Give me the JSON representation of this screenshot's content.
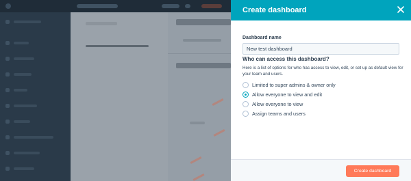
{
  "drawer": {
    "title": "Create dashboard",
    "close_icon": "close-icon",
    "name_label": "Dashboard name",
    "name_value": "New test dashboard",
    "access_heading": "Who can access this dashboard?",
    "access_description": "Here is a list of options for who has access to view, edit, or set up as default view for your team and users.",
    "options": [
      {
        "label": "Limited to super admins & owner only",
        "selected": false
      },
      {
        "label": "Allow everyone to view and edit",
        "selected": true
      },
      {
        "label": "Allow everyone to view",
        "selected": false
      },
      {
        "label": "Assign teams and users",
        "selected": false
      }
    ],
    "create_button": "Create dashboard"
  },
  "colors": {
    "header": "#00a4bd",
    "primary_button": "#ff7a59",
    "radio_accent": "#00a4bd",
    "overlay": "#8a939c"
  }
}
